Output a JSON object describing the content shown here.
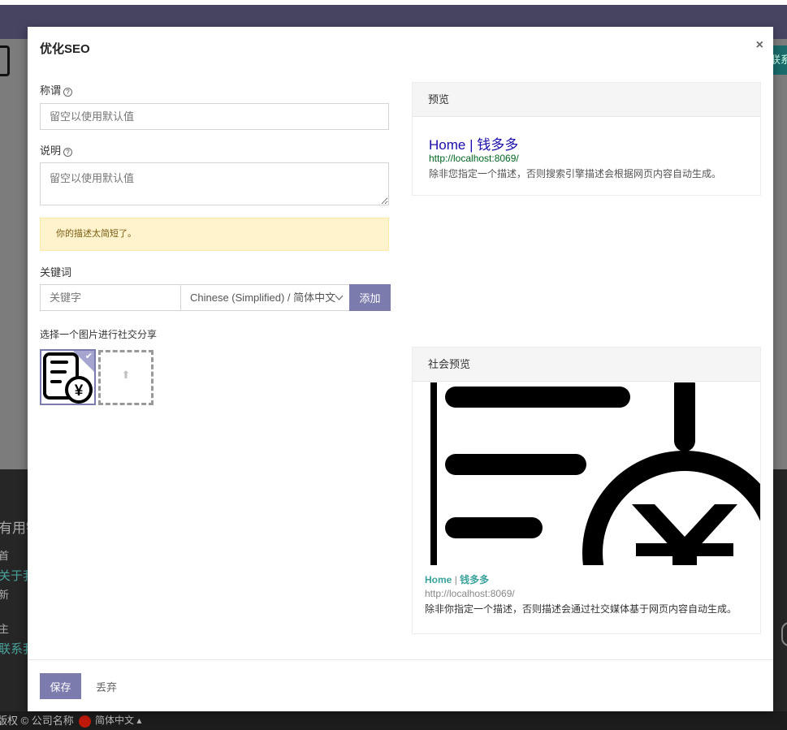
{
  "background": {
    "topbar_color": "#474462",
    "right_button_label": "联系",
    "footer_items": [
      "有用链接",
      "首",
      "关于我们",
      "新",
      "主",
      "联系我们"
    ],
    "copyright": "版权 © 公司名称",
    "language": "简体中文 ▴"
  },
  "modal": {
    "title": "优化SEO",
    "close_symbol": "×",
    "title_field": {
      "label": "称谓",
      "help_symbol": "?",
      "placeholder": "留空以使用默认值",
      "value": ""
    },
    "description_field": {
      "label": "说明",
      "help_symbol": "?",
      "placeholder": "留空以使用默认值",
      "value": ""
    },
    "warning": "你的描述太简短了。",
    "keywords": {
      "label": "关键词",
      "placeholder": "关键字",
      "language_selected": "Chinese (Simplified) / 简体中文",
      "add_label": "添加"
    },
    "image_section": {
      "label": "选择一个图片进行社交分享",
      "check_symbol": "✔",
      "upload_symbol": "⬆"
    },
    "preview": {
      "header": "预览",
      "title": "Home | 钱多多",
      "url": "http://localhost:8069/",
      "description": "除非您指定一个描述，否则搜索引擎描述会根据网页内容自动生成。"
    },
    "social_preview": {
      "header": "社会预览",
      "title_left": "Home",
      "title_sep": "|",
      "title_right": "钱多多",
      "url": "http://localhost:8069/",
      "description": "除非你指定一个描述，否则描述会通过社交媒体基于网页内容自动生成。"
    },
    "footer": {
      "save_label": "保存",
      "discard_label": "丢弃"
    }
  },
  "colors": {
    "primary": "#7c7bad",
    "warning_bg": "#fff3cd",
    "serp_title": "#1a0dab",
    "serp_url": "#006621",
    "social_accent": "#3aa39c"
  },
  "icons": [
    "help-icon",
    "close-icon",
    "check-icon",
    "upload-icon",
    "invoice-yen-icon",
    "chevron-down-icon"
  ]
}
